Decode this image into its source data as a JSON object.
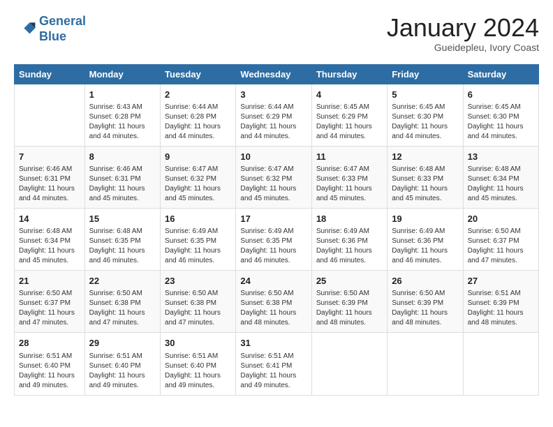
{
  "header": {
    "logo_line1": "General",
    "logo_line2": "Blue",
    "month": "January 2024",
    "location": "Gueidepleu, Ivory Coast"
  },
  "columns": [
    "Sunday",
    "Monday",
    "Tuesday",
    "Wednesday",
    "Thursday",
    "Friday",
    "Saturday"
  ],
  "weeks": [
    [
      {
        "day": "",
        "info": ""
      },
      {
        "day": "1",
        "info": "Sunrise: 6:43 AM\nSunset: 6:28 PM\nDaylight: 11 hours\nand 44 minutes."
      },
      {
        "day": "2",
        "info": "Sunrise: 6:44 AM\nSunset: 6:28 PM\nDaylight: 11 hours\nand 44 minutes."
      },
      {
        "day": "3",
        "info": "Sunrise: 6:44 AM\nSunset: 6:29 PM\nDaylight: 11 hours\nand 44 minutes."
      },
      {
        "day": "4",
        "info": "Sunrise: 6:45 AM\nSunset: 6:29 PM\nDaylight: 11 hours\nand 44 minutes."
      },
      {
        "day": "5",
        "info": "Sunrise: 6:45 AM\nSunset: 6:30 PM\nDaylight: 11 hours\nand 44 minutes."
      },
      {
        "day": "6",
        "info": "Sunrise: 6:45 AM\nSunset: 6:30 PM\nDaylight: 11 hours\nand 44 minutes."
      }
    ],
    [
      {
        "day": "7",
        "info": "Sunrise: 6:46 AM\nSunset: 6:31 PM\nDaylight: 11 hours\nand 44 minutes."
      },
      {
        "day": "8",
        "info": "Sunrise: 6:46 AM\nSunset: 6:31 PM\nDaylight: 11 hours\nand 45 minutes."
      },
      {
        "day": "9",
        "info": "Sunrise: 6:47 AM\nSunset: 6:32 PM\nDaylight: 11 hours\nand 45 minutes."
      },
      {
        "day": "10",
        "info": "Sunrise: 6:47 AM\nSunset: 6:32 PM\nDaylight: 11 hours\nand 45 minutes."
      },
      {
        "day": "11",
        "info": "Sunrise: 6:47 AM\nSunset: 6:33 PM\nDaylight: 11 hours\nand 45 minutes."
      },
      {
        "day": "12",
        "info": "Sunrise: 6:48 AM\nSunset: 6:33 PM\nDaylight: 11 hours\nand 45 minutes."
      },
      {
        "day": "13",
        "info": "Sunrise: 6:48 AM\nSunset: 6:34 PM\nDaylight: 11 hours\nand 45 minutes."
      }
    ],
    [
      {
        "day": "14",
        "info": "Sunrise: 6:48 AM\nSunset: 6:34 PM\nDaylight: 11 hours\nand 45 minutes."
      },
      {
        "day": "15",
        "info": "Sunrise: 6:48 AM\nSunset: 6:35 PM\nDaylight: 11 hours\nand 46 minutes."
      },
      {
        "day": "16",
        "info": "Sunrise: 6:49 AM\nSunset: 6:35 PM\nDaylight: 11 hours\nand 46 minutes."
      },
      {
        "day": "17",
        "info": "Sunrise: 6:49 AM\nSunset: 6:35 PM\nDaylight: 11 hours\nand 46 minutes."
      },
      {
        "day": "18",
        "info": "Sunrise: 6:49 AM\nSunset: 6:36 PM\nDaylight: 11 hours\nand 46 minutes."
      },
      {
        "day": "19",
        "info": "Sunrise: 6:49 AM\nSunset: 6:36 PM\nDaylight: 11 hours\nand 46 minutes."
      },
      {
        "day": "20",
        "info": "Sunrise: 6:50 AM\nSunset: 6:37 PM\nDaylight: 11 hours\nand 47 minutes."
      }
    ],
    [
      {
        "day": "21",
        "info": "Sunrise: 6:50 AM\nSunset: 6:37 PM\nDaylight: 11 hours\nand 47 minutes."
      },
      {
        "day": "22",
        "info": "Sunrise: 6:50 AM\nSunset: 6:38 PM\nDaylight: 11 hours\nand 47 minutes."
      },
      {
        "day": "23",
        "info": "Sunrise: 6:50 AM\nSunset: 6:38 PM\nDaylight: 11 hours\nand 47 minutes."
      },
      {
        "day": "24",
        "info": "Sunrise: 6:50 AM\nSunset: 6:38 PM\nDaylight: 11 hours\nand 48 minutes."
      },
      {
        "day": "25",
        "info": "Sunrise: 6:50 AM\nSunset: 6:39 PM\nDaylight: 11 hours\nand 48 minutes."
      },
      {
        "day": "26",
        "info": "Sunrise: 6:50 AM\nSunset: 6:39 PM\nDaylight: 11 hours\nand 48 minutes."
      },
      {
        "day": "27",
        "info": "Sunrise: 6:51 AM\nSunset: 6:39 PM\nDaylight: 11 hours\nand 48 minutes."
      }
    ],
    [
      {
        "day": "28",
        "info": "Sunrise: 6:51 AM\nSunset: 6:40 PM\nDaylight: 11 hours\nand 49 minutes."
      },
      {
        "day": "29",
        "info": "Sunrise: 6:51 AM\nSunset: 6:40 PM\nDaylight: 11 hours\nand 49 minutes."
      },
      {
        "day": "30",
        "info": "Sunrise: 6:51 AM\nSunset: 6:40 PM\nDaylight: 11 hours\nand 49 minutes."
      },
      {
        "day": "31",
        "info": "Sunrise: 6:51 AM\nSunset: 6:41 PM\nDaylight: 11 hours\nand 49 minutes."
      },
      {
        "day": "",
        "info": ""
      },
      {
        "day": "",
        "info": ""
      },
      {
        "day": "",
        "info": ""
      }
    ]
  ]
}
